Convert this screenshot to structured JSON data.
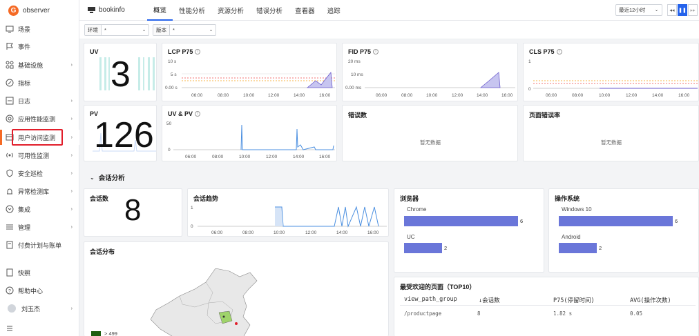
{
  "app": {
    "logo_text": "observer",
    "name": "bookinfo"
  },
  "sidebar": {
    "items": [
      {
        "label": "场景",
        "chev": ""
      },
      {
        "label": "事件",
        "chev": ""
      },
      {
        "label": "基础设施",
        "chev": "›"
      },
      {
        "label": "指标",
        "chev": ""
      },
      {
        "label": "日志",
        "chev": "›"
      },
      {
        "label": "应用性能监测",
        "chev": "›"
      },
      {
        "label": "用户访问监测",
        "chev": "›"
      },
      {
        "label": "可用性监测",
        "chev": "›"
      },
      {
        "label": "安全巡检",
        "chev": "›"
      },
      {
        "label": "异常检测库",
        "chev": "›"
      },
      {
        "label": "集成",
        "chev": "›"
      },
      {
        "label": "管理",
        "chev": "›"
      },
      {
        "label": "付费计划与账单",
        "chev": ""
      }
    ],
    "bottom": [
      {
        "label": "快照"
      },
      {
        "label": "帮助中心"
      },
      {
        "label": "刘玉杰",
        "chev": "›"
      }
    ]
  },
  "tabs": [
    "概览",
    "性能分析",
    "资源分析",
    "错误分析",
    "查看器",
    "追踪"
  ],
  "time_range": {
    "label": "最近12小时",
    "rewind": "◂◂",
    "pause": "❚❚",
    "forward": "▸▸"
  },
  "filters": [
    {
      "label": "环境",
      "value": "*"
    },
    {
      "label": "版本",
      "value": "*"
    }
  ],
  "cards": {
    "uv": {
      "title": "UV",
      "value": "3"
    },
    "lcp": {
      "title": "LCP P75",
      "y_ticks": [
        "10 s",
        "5 s",
        "0.00 s"
      ]
    },
    "fid": {
      "title": "FID P75",
      "y_ticks": [
        "20 ms",
        "10 ms",
        "0.00 ms"
      ]
    },
    "cls": {
      "title": "CLS P75",
      "y_ticks": [
        "1",
        "0"
      ]
    },
    "pv": {
      "title": "PV",
      "value": "126"
    },
    "uvpv": {
      "title": "UV & PV",
      "y_ticks": [
        "50",
        "0"
      ]
    },
    "errors": {
      "title": "错误数",
      "empty": "暂无数据"
    },
    "page_error_rate": {
      "title": "页面错误率",
      "empty": "暂无数据"
    }
  },
  "x_ticks": [
    "06:00",
    "08:00",
    "10:00",
    "12:00",
    "14:00",
    "16:00"
  ],
  "session": {
    "section_title": "会话分析",
    "count": {
      "title": "会话数",
      "value": "8"
    },
    "trend": {
      "title": "会话趋势",
      "y_ticks": [
        "1",
        "0"
      ]
    },
    "distribution": {
      "title": "会话分布",
      "legend_label": "> 499"
    },
    "browser": {
      "title": "浏览器",
      "items": [
        {
          "name": "Chrome",
          "value": 6
        },
        {
          "name": "UC",
          "value": 2
        }
      ]
    },
    "os": {
      "title": "操作系统",
      "items": [
        {
          "name": "Windows 10",
          "value": 6
        },
        {
          "name": "Android",
          "value": 2
        }
      ]
    },
    "top_pages": {
      "title": "最受欢迎的页面（TOP10）",
      "headers": [
        "view_path_group",
        "↓会话数",
        "P75(停留时间)",
        "AVG(操作次数)"
      ],
      "rows": [
        [
          "/productpage",
          "8",
          "1.82 s",
          "0.05"
        ]
      ]
    }
  },
  "colors": {
    "accent": "#f56a25",
    "primary": "#2563eb",
    "bar": "#6a76d9",
    "highlight": "#e11d2a"
  }
}
